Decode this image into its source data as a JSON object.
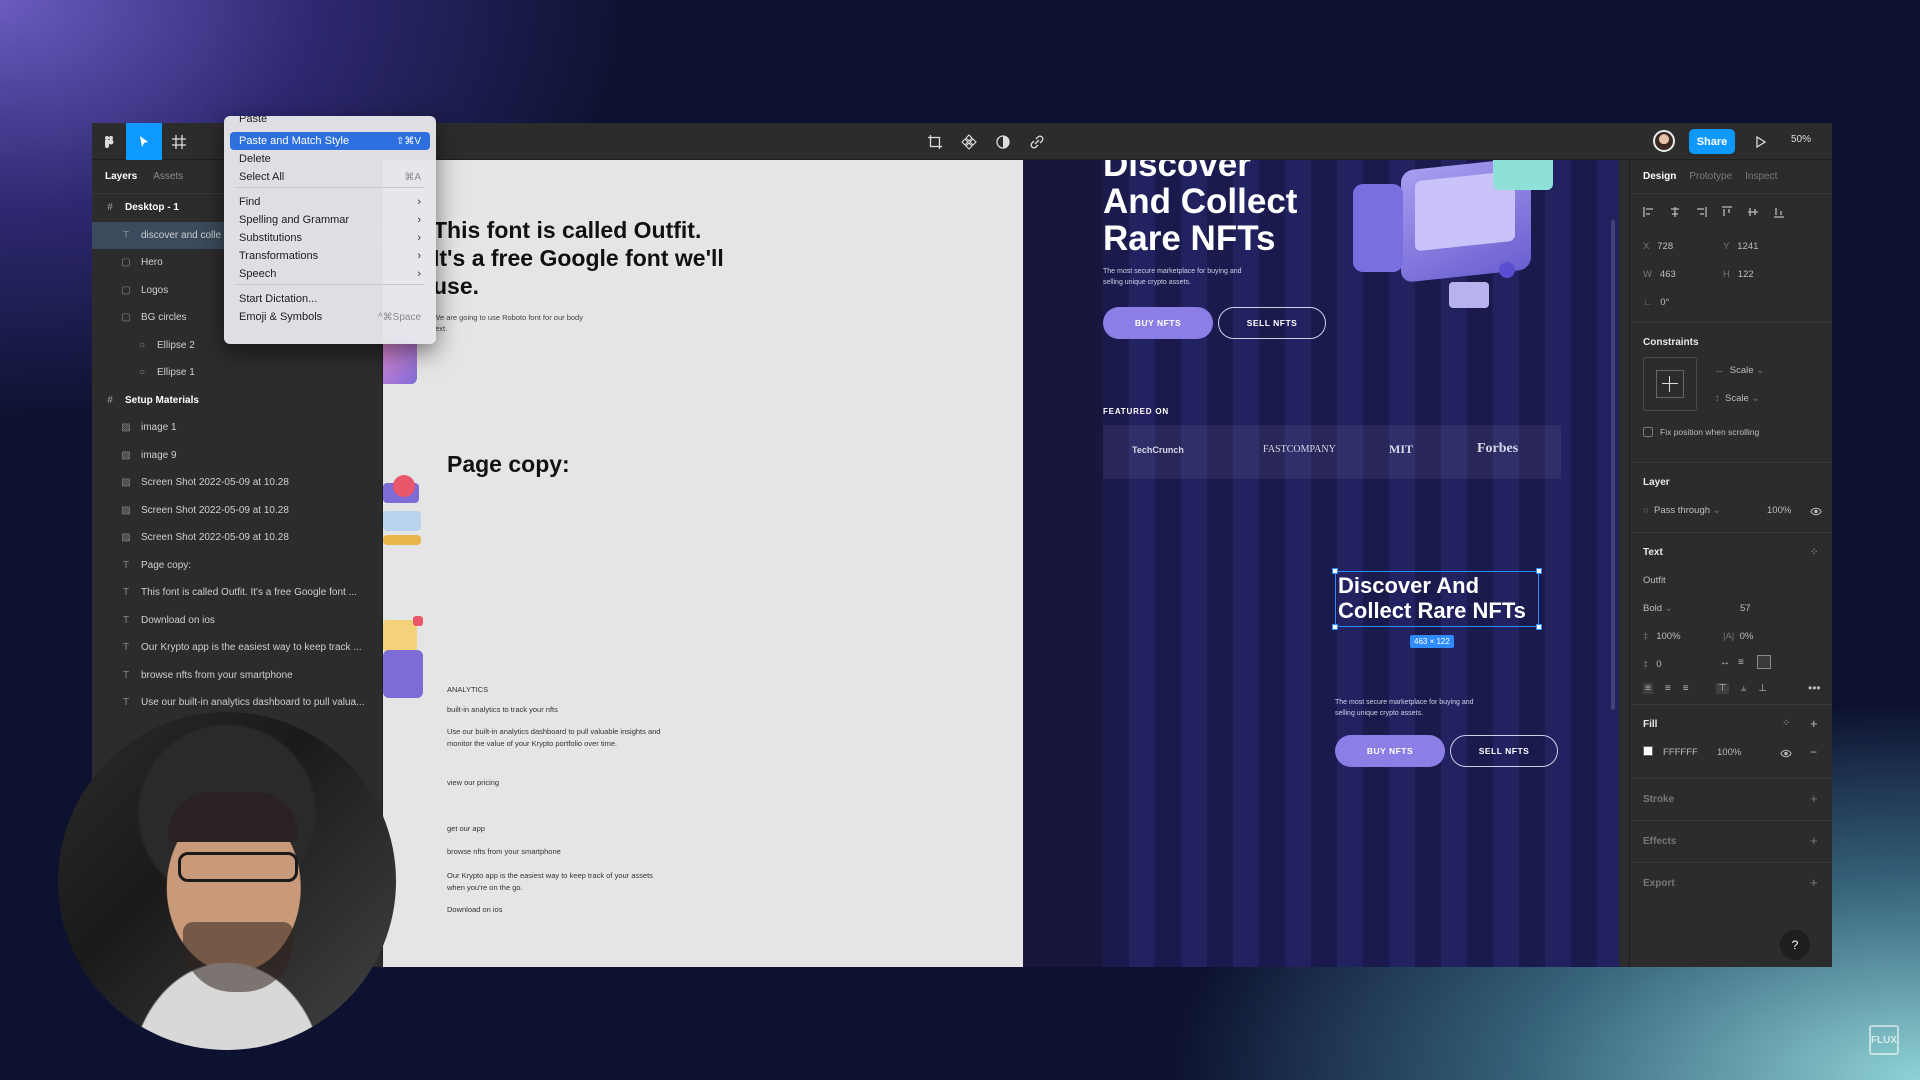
{
  "toolbar": {
    "share": "Share",
    "zoom": "50%"
  },
  "layers_panel": {
    "tabs": [
      "Layers",
      "Assets"
    ],
    "items": [
      {
        "label": "Desktop - 1",
        "kind": "frame",
        "depth": 0
      },
      {
        "label": "discover and colle",
        "kind": "text",
        "depth": 1,
        "selected": true
      },
      {
        "label": "Hero",
        "kind": "group",
        "depth": 1
      },
      {
        "label": "Logos",
        "kind": "group",
        "depth": 1
      },
      {
        "label": "BG circles",
        "kind": "group",
        "depth": 1
      },
      {
        "label": "Ellipse 2",
        "kind": "ellipse",
        "depth": 2
      },
      {
        "label": "Ellipse 1",
        "kind": "ellipse",
        "depth": 2
      },
      {
        "label": "Setup Materials",
        "kind": "frame",
        "depth": 0
      },
      {
        "label": "image 1",
        "kind": "image",
        "depth": 1
      },
      {
        "label": "image 9",
        "kind": "image",
        "depth": 1
      },
      {
        "label": "Screen Shot 2022-05-09 at 10.28",
        "kind": "image",
        "depth": 1
      },
      {
        "label": "Screen Shot 2022-05-09 at 10.28",
        "kind": "image",
        "depth": 1
      },
      {
        "label": "Screen Shot 2022-05-09 at 10.28",
        "kind": "image",
        "depth": 1
      },
      {
        "label": "Page copy:",
        "kind": "text",
        "depth": 1
      },
      {
        "label": "This font is called Outfit. It's a free Google font ...",
        "kind": "text",
        "depth": 1
      },
      {
        "label": "Download on ios",
        "kind": "text",
        "depth": 1
      },
      {
        "label": "Our Krypto app is the easiest way to keep track ...",
        "kind": "text",
        "depth": 1
      },
      {
        "label": "browse nfts from your smartphone",
        "kind": "text",
        "depth": 1
      },
      {
        "label": "Use our built-in analytics dashboard to pull valua...",
        "kind": "text",
        "depth": 1
      }
    ]
  },
  "context_menu": {
    "items": [
      {
        "label": "Paste",
        "shortcut": ""
      },
      {
        "label": "Paste and Match Style",
        "shortcut": "⇧⌘V",
        "highlighted": true
      },
      {
        "label": "Delete",
        "shortcut": ""
      },
      {
        "label": "Select All",
        "shortcut": "⌘A"
      },
      {
        "label": "Find",
        "submenu": true
      },
      {
        "label": "Spelling and Grammar",
        "submenu": true
      },
      {
        "label": "Substitutions",
        "submenu": true
      },
      {
        "label": "Transformations",
        "submenu": true
      },
      {
        "label": "Speech",
        "submenu": true
      },
      {
        "label": "Start Dictation...",
        "shortcut": ""
      },
      {
        "label": "Emoji & Symbols",
        "shortcut": "^⌘Space"
      }
    ]
  },
  "setup_canvas": {
    "font_heading": "This font is called Outfit. It's a free Google font we'll use.",
    "font_body": "We are going to use Roboto font for our body text.",
    "page_copy": "Page copy:",
    "analytics": "ANALYTICS",
    "analytics_sub": "built-in analytics to track your nfts",
    "analytics_body": "Use our built-in analytics dashboard to pull valuable insights and monitor the value of your Krypto portfolio over time.",
    "pricing": "view our pricing",
    "get_app": "get our app",
    "browse": "browse nfts from your smartphone",
    "krypto": "Our Krypto app is the easiest way to keep track of your assets when you're on the go.",
    "download": "Download on ios"
  },
  "site": {
    "hero_title": "Discover And Collect Rare NFTs",
    "hero_sub": "The most secure marketplace for buying and selling unique crypto assets.",
    "buy": "BUY NFTS",
    "sell": "SELL NFTS",
    "featured": "FEATURED ON",
    "logos": [
      "TechCrunch",
      "FASTCOMPANY",
      "MIT",
      "Forbes"
    ],
    "copy_title": "Discover And Collect Rare NFTs",
    "size_badge": "463 × 122",
    "copy_sub": "The most secure marketplace for buying and selling unique crypto assets.",
    "buy2": "BUY NFTS",
    "sell2": "SELL NFTS"
  },
  "design_panel": {
    "tabs": [
      "Design",
      "Prototype",
      "Inspect"
    ],
    "x": "728",
    "y": "1241",
    "w": "463",
    "h": "122",
    "rotation": "0°",
    "constraints_title": "Constraints",
    "constraint_h": "Scale",
    "constraint_v": "Scale",
    "fix_position": "Fix position when scrolling",
    "layer_title": "Layer",
    "blend": "Pass through",
    "opacity": "100%",
    "text_title": "Text",
    "font": "Outfit",
    "weight": "Bold",
    "size": "57",
    "line_height": "100%",
    "letter_spacing": "0%",
    "para_spacing": "0",
    "fill_title": "Fill",
    "fill_hex": "FFFFFF",
    "fill_opacity": "100%",
    "stroke": "Stroke",
    "effects": "Effects",
    "export": "Export",
    "help": "?"
  },
  "watermark": "FLUX"
}
